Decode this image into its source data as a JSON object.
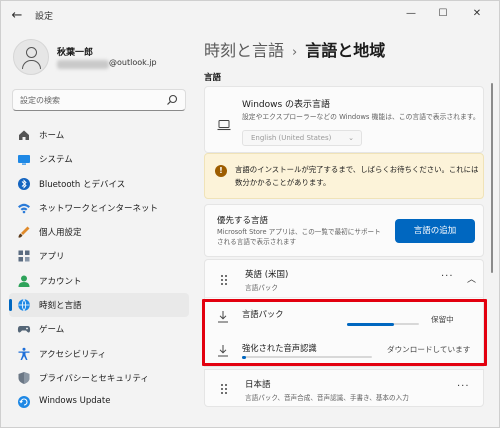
{
  "window": {
    "title": "設定",
    "controls": {
      "minimize": "—",
      "maximize": "☐",
      "close": "✕"
    }
  },
  "user": {
    "name": "秋葉一郎",
    "email_visible": "@outlook.jp"
  },
  "search": {
    "placeholder": "設定の検索"
  },
  "sidebar": {
    "items": [
      {
        "label": "ホーム",
        "icon": "home-icon"
      },
      {
        "label": "システム",
        "icon": "system-icon"
      },
      {
        "label": "Bluetooth とデバイス",
        "icon": "bluetooth-icon"
      },
      {
        "label": "ネットワークとインターネット",
        "icon": "network-icon"
      },
      {
        "label": "個人用設定",
        "icon": "personalization-icon"
      },
      {
        "label": "アプリ",
        "icon": "apps-icon"
      },
      {
        "label": "アカウント",
        "icon": "account-icon"
      },
      {
        "label": "時刻と言語",
        "icon": "time-language-icon",
        "active": true
      },
      {
        "label": "ゲーム",
        "icon": "gaming-icon"
      },
      {
        "label": "アクセシビリティ",
        "icon": "accessibility-icon"
      },
      {
        "label": "プライバシーとセキュリティ",
        "icon": "privacy-icon"
      },
      {
        "label": "Windows Update",
        "icon": "windows-update-icon"
      }
    ]
  },
  "breadcrumb": {
    "parent": "時刻と言語",
    "separator": "›",
    "current": "言語と地域"
  },
  "section": {
    "title": "言語"
  },
  "display_language": {
    "title": "Windows の表示言語",
    "subtitle": "設定やエクスプローラーなどの Windows 機能は、この言語で表示されます。",
    "selected": "English (United States)"
  },
  "warning": {
    "text": "言語のインストールが完了するまで、しばらくお待ちください。これには数分かかることがあります。"
  },
  "preferred": {
    "title": "優先する言語",
    "subtitle": "Microsoft Store アプリは、この一覧で最初にサポートされる言語で表示されます",
    "add_button": "言語の追加"
  },
  "languages": [
    {
      "name": "英語 (米国)",
      "subtitle": "言語パック",
      "expanded": true,
      "downloads": [
        {
          "label": "言語パック",
          "status": "保留中",
          "progress": 0.65
        },
        {
          "label": "強化された音声認識",
          "status": "ダウンロードしています",
          "progress": 0.03
        }
      ]
    },
    {
      "name": "日本語",
      "subtitle": "言語パック、音声合成、音声認識、手書き、基本の入力"
    }
  ],
  "colors": {
    "accent": "#0067c0",
    "highlight": "#e3000f",
    "warning_bg": "#fcf3d9"
  }
}
